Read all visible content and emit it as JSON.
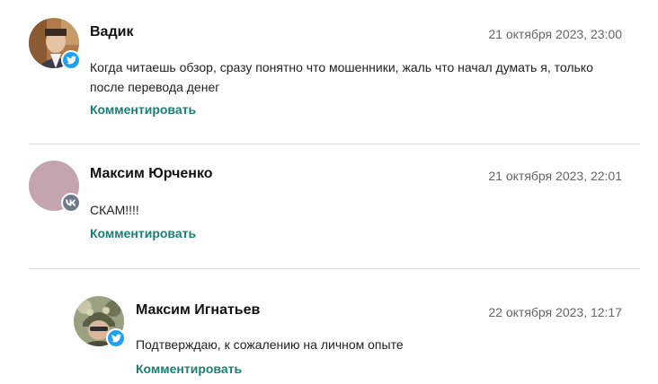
{
  "comments": [
    {
      "author": "Вадик",
      "date": "21 октября 2023, 23:00",
      "text": "Когда читаешь обзор, сразу понятно что мошенники, жаль что начал думать я, только после перевода денег",
      "reply_label": "Комментировать",
      "network_icon": "twitter-icon",
      "network_color": "#1da1f2"
    },
    {
      "author": "Максим Юрченко",
      "date": "21 октября 2023, 22:01",
      "text": "СКАМ!!!!",
      "reply_label": "Комментировать",
      "network_icon": "vk-icon",
      "network_color": "#6c7a89"
    },
    {
      "author": "Максим Игнатьев",
      "date": "22 октября 2023, 12:17",
      "text": "Подтверждаю, к сожалению на личном опыте",
      "reply_label": "Комментировать",
      "network_icon": "twitter-icon",
      "network_color": "#1da1f2"
    }
  ],
  "colors": {
    "accent": "#1a7f74",
    "date": "#666666",
    "divider": "#dcdcdc"
  }
}
